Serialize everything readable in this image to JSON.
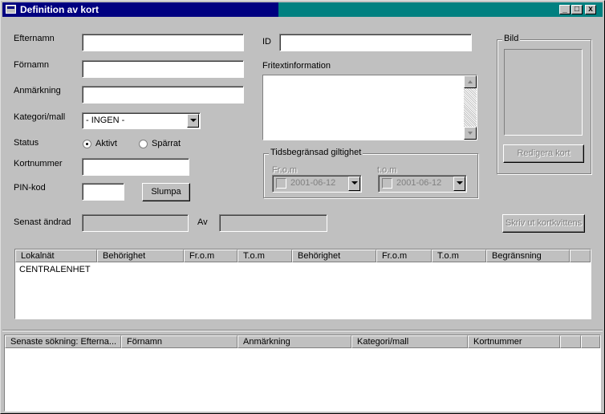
{
  "window": {
    "title": "Definition av kort",
    "controls": [
      "_",
      "□",
      "x"
    ]
  },
  "form": {
    "efternamn": {
      "label": "Efternamn",
      "value": ""
    },
    "fornamn": {
      "label": "Förnamn",
      "value": ""
    },
    "anmarkning": {
      "label": "Anmärkning",
      "value": ""
    },
    "kategori": {
      "label": "Kategori/mall",
      "value": "- INGEN -"
    },
    "status": {
      "label": "Status",
      "options": [
        "Aktivt",
        "Spärrat"
      ],
      "selected": "Aktivt"
    },
    "kortnummer": {
      "label": "Kortnummer",
      "value": ""
    },
    "pinkod": {
      "label": "PIN-kod",
      "value": ""
    },
    "slumpa_label": "Slumpa",
    "id": {
      "label": "ID",
      "value": ""
    },
    "fritext": {
      "label": "Fritextinformation",
      "value": ""
    },
    "senast_andrad": {
      "label": "Senast ändrad",
      "value": ""
    },
    "av": {
      "label": "Av",
      "value": ""
    }
  },
  "validity": {
    "title": "Tidsbegränsad giltighet",
    "from_label": "Fr.o.m",
    "to_label": "t.o.m",
    "from_date": "2001-06-12",
    "to_date": "2001-06-12"
  },
  "picture": {
    "title": "Bild",
    "edit_label": "Redigera kort"
  },
  "print_label": "Skriv ut kortkvittens",
  "access_table": {
    "columns": [
      "Lokalnät",
      "Behörighet",
      "Fr.o.m",
      "T.o.m",
      "Behörighet",
      "Fr.o.m",
      "T.o.m",
      "Begränsning"
    ],
    "rows": [
      [
        "CENTRALENHET",
        "",
        "",
        "",
        "",
        "",
        "",
        ""
      ]
    ]
  },
  "search_table": {
    "columns": [
      "Senaste sökning: Efterna...",
      "Förnamn",
      "Anmärkning",
      "Kategori/mall",
      "Kortnummer",
      "",
      ""
    ],
    "rows": []
  }
}
